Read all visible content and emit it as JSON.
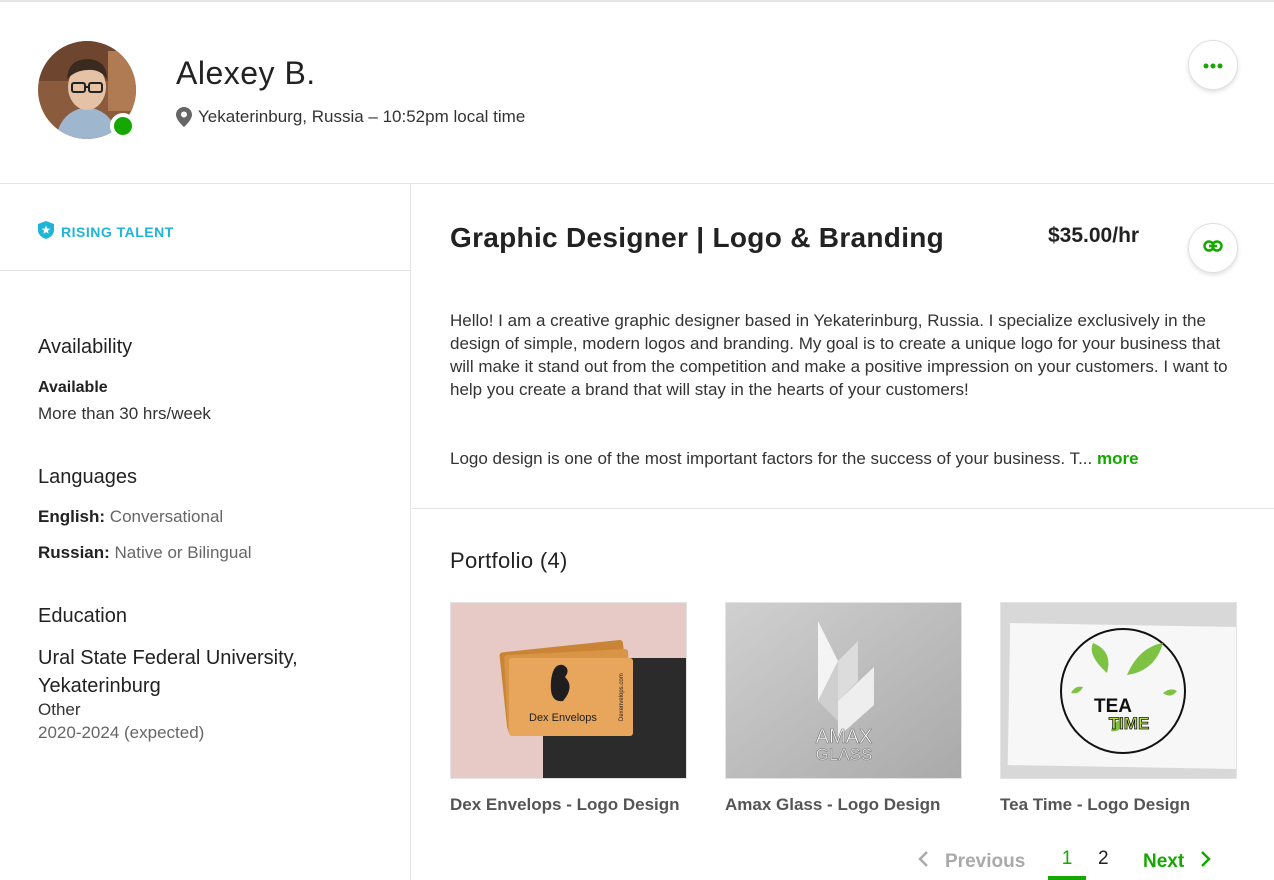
{
  "profile": {
    "name": "Alexey B.",
    "location": "Yekaterinburg, Russia – 10:52pm local time",
    "online_color": "#14a800"
  },
  "badge": {
    "label": "RISING TALENT",
    "color": "#1fb5d9"
  },
  "availability": {
    "heading": "Availability",
    "status": "Available",
    "hours": "More than 30 hrs/week"
  },
  "languages": {
    "heading": "Languages",
    "items": [
      {
        "name": "English:",
        "level": "Conversational"
      },
      {
        "name": "Russian:",
        "level": "Native or Bilingual"
      }
    ]
  },
  "education": {
    "heading": "Education",
    "school": "Ural State Federal University, Yekaterinburg",
    "degree": "Other",
    "years": "2020-2024 (expected)"
  },
  "job": {
    "title": "Graphic Designer | Logo & Branding",
    "rate": "$35.00/hr",
    "bio_p1": "Hello! I am a creative graphic designer based in Yekaterinburg, Russia. I specialize exclusively in the design of simple, modern logos and branding. My goal is to create a unique logo for your business that will make it stand out from the competition and make a positive impression on your customers. I want to help you create a brand that will stay in the hearts of your customers!",
    "bio_p2": "Logo design is one of the most important factors for the success of your business. T...",
    "more_label": "more"
  },
  "portfolio": {
    "heading": "Portfolio (4)",
    "items": [
      {
        "title": "Dex Envelops - Logo Design",
        "thumb_brand": "Dex Envelops",
        "thumb_url_text": "Dexenvelops.com"
      },
      {
        "title": "Amax Glass - Logo Design",
        "thumb_line1": "AMAX",
        "thumb_line2": "GLASS"
      },
      {
        "title": "Tea Time - Logo Design",
        "thumb_line1": "TEA",
        "thumb_line2": "TIME"
      }
    ]
  },
  "pagination": {
    "prev_label": "Previous",
    "pages": [
      "1",
      "2"
    ],
    "current": "1",
    "next_label": "Next"
  },
  "colors": {
    "accent": "#14a800",
    "divider": "#e4e4e4"
  }
}
